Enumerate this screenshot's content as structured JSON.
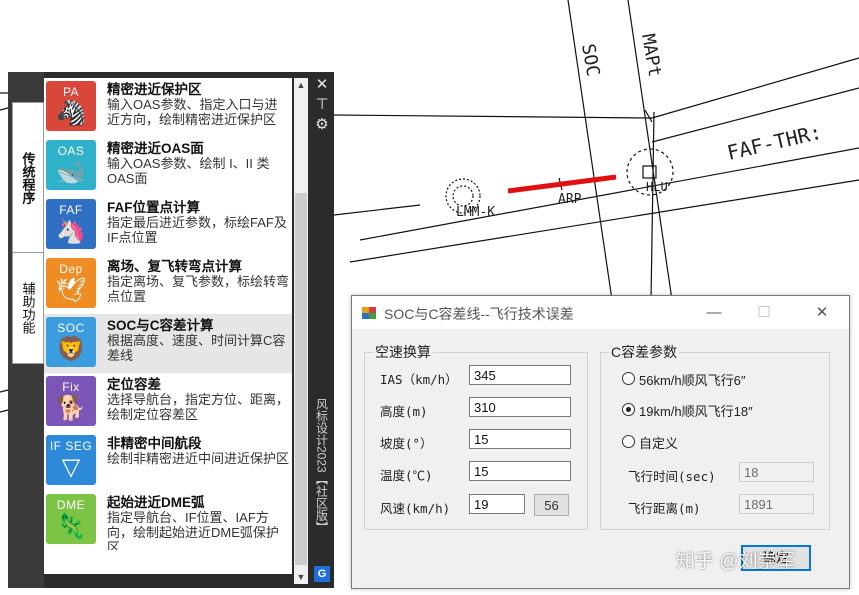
{
  "cad": {
    "labels": {
      "soc": "SOC",
      "mapt": "MAPt",
      "faf_thr": "FAF-THR:",
      "arp": "ARP",
      "lmm": "LMM-K",
      "hlu": "HLU"
    },
    "colors": {
      "line": "#111111",
      "segment": "#e01010"
    }
  },
  "palette": {
    "tabs": [
      {
        "label": "传统程序",
        "active": true
      },
      {
        "label": "辅助功能",
        "active": false
      }
    ],
    "window_title": "风标设计2023【社区版】",
    "controls": {
      "close_icon": "✕",
      "pin_icon": "⊤",
      "settings_icon": "⚙"
    },
    "scroll": {
      "up_icon": "▲",
      "down_icon": "▼"
    },
    "brand_logo": "G",
    "items": [
      {
        "code": "PA",
        "glyph": "🦓",
        "icon": "zebra-icon",
        "color": "#d9463a",
        "title": "精密进近保护区",
        "desc": "输入OAS参数、指定入口与进近方向，绘制精密进近保护区"
      },
      {
        "code": "OAS",
        "glyph": "🐋",
        "icon": "whale-icon",
        "color": "#2fb2c9",
        "title": "精密进近OAS面",
        "desc": "输入OAS参数、绘制 I、II 类OAS面"
      },
      {
        "code": "FAF",
        "glyph": "🦄",
        "icon": "unicorn-icon",
        "color": "#2f6fc4",
        "title": "FAF位置点计算",
        "desc": "指定最后进近参数，标绘FAF及IF点位置"
      },
      {
        "code": "Dep",
        "glyph": "🕊",
        "icon": "bird-icon",
        "color": "#f08c24",
        "title": "离场、复飞转弯点计算",
        "desc": "指定离场、复飞参数，标绘转弯点位置"
      },
      {
        "code": "SOC",
        "glyph": "🦁",
        "icon": "lion-icon",
        "color": "#3b9de0",
        "title": "SOC与C容差计算",
        "desc": "根据高度、速度、时间计算C容差线"
      },
      {
        "code": "Fix",
        "glyph": "🐕",
        "icon": "dog-icon",
        "color": "#7b55b8",
        "title": "定位容差",
        "desc": "选择导航台，指定方位、距离，绘制定位容差区"
      },
      {
        "code": "IF SEG",
        "glyph": "▽",
        "icon": "segment-icon",
        "color": "#2d8ad8",
        "title": "非精密中间航段",
        "desc": "绘制非精密进近中间进近保护区"
      },
      {
        "code": "DME",
        "glyph": "🦎",
        "icon": "lizard-icon",
        "color": "#7cc444",
        "title": "起始进近DME弧",
        "desc": "指定导航台、IF位置、IAF方向，绘制起始进近DME弧保护区"
      }
    ],
    "selected_index": 4
  },
  "dialog": {
    "title": "SOC与C容差线--飞行技术误差",
    "buttons": {
      "minimize": "—",
      "maximize": "☐",
      "close": "✕",
      "ok": "确定"
    },
    "airspeed_group": {
      "legend": "空速换算",
      "fields": [
        {
          "label": "IAS（km/h）",
          "value": "345"
        },
        {
          "label": "高度(m)",
          "value": "310"
        },
        {
          "label": "坡度(°）",
          "value": "15"
        },
        {
          "label": "温度(℃)",
          "value": "15"
        }
      ],
      "wind": {
        "label": "风速(km/h)",
        "value": "19",
        "output": "56"
      }
    },
    "c_group": {
      "legend": "C容差参数",
      "options": [
        {
          "label": "56km/h顺风飞行6″",
          "checked": false
        },
        {
          "label": "19km/h顺风飞行18″",
          "checked": true
        },
        {
          "label": "自定义",
          "checked": false
        }
      ],
      "time": {
        "label": "飞行时间(sec)",
        "value": "18"
      },
      "distance": {
        "label": "飞行距离(m)",
        "value": "1891"
      }
    }
  },
  "watermark": "知乎 @刘崇军"
}
